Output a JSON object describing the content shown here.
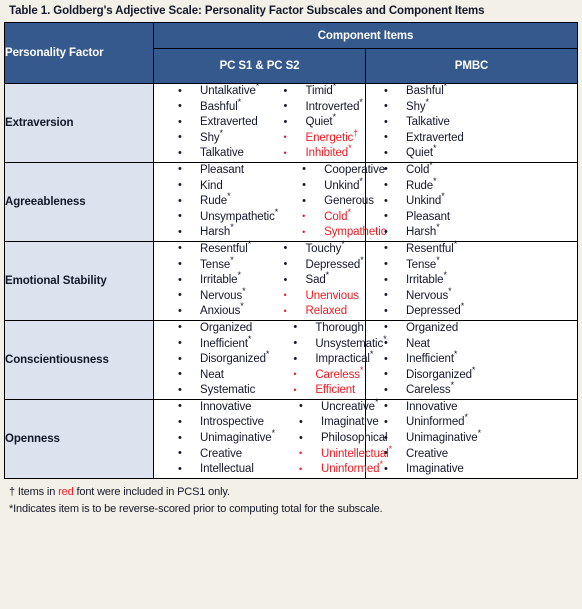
{
  "title": "Table 1. Goldberg's Adjective Scale: Personality Factor Subscales and Component Items",
  "colors": {
    "header_blue": "#35598c",
    "factor_cell_bg": "#dce3ee",
    "red_accent": "#ed1c24",
    "page_bg": "#f3f0e7"
  },
  "header": {
    "factor_label": "Personality Factor",
    "component_items_label": "Component Items",
    "pcs_label": "PC S1 & PC S2",
    "pmbc_label": "PMBC"
  },
  "rows": [
    {
      "factor": "Extraversion",
      "pcs_col1": [
        {
          "text": "Untalkative*",
          "red": false
        },
        {
          "text": "Bashful*",
          "red": false
        },
        {
          "text": "Extraverted",
          "red": false
        },
        {
          "text": "Shy*",
          "red": false
        },
        {
          "text": "Talkative",
          "red": false
        }
      ],
      "pcs_col2": [
        {
          "text": "Timid*",
          "red": false
        },
        {
          "text": "Introverted*",
          "red": false
        },
        {
          "text": "Quiet*",
          "red": false
        },
        {
          "text": "Energetic†",
          "red": true
        },
        {
          "text": "Inhibited*",
          "red": true
        }
      ],
      "pmbc": [
        {
          "text": "Bashful*",
          "red": false
        },
        {
          "text": "Shy*",
          "red": false
        },
        {
          "text": "Talkative",
          "red": false
        },
        {
          "text": "Extraverted",
          "red": false
        },
        {
          "text": "Quiet*",
          "red": false
        }
      ]
    },
    {
      "factor": "Agreeableness",
      "pcs_col1": [
        {
          "text": "Pleasant",
          "red": false
        },
        {
          "text": "Kind",
          "red": false
        },
        {
          "text": "Rude*",
          "red": false
        },
        {
          "text": "Unsympathetic*",
          "red": false
        },
        {
          "text": "Harsh*",
          "red": false
        }
      ],
      "pcs_col2": [
        {
          "text": "Cooperative",
          "red": false
        },
        {
          "text": "Unkind*",
          "red": false
        },
        {
          "text": "Generous",
          "red": false
        },
        {
          "text": "Cold*",
          "red": true
        },
        {
          "text": "Sympathetic",
          "red": true
        }
      ],
      "pmbc": [
        {
          "text": "Cold*",
          "red": false
        },
        {
          "text": "Rude*",
          "red": false
        },
        {
          "text": "Unkind*",
          "red": false
        },
        {
          "text": "Pleasant",
          "red": false
        },
        {
          "text": "Harsh*",
          "red": false
        }
      ]
    },
    {
      "factor": "Emotional Stability",
      "pcs_col1": [
        {
          "text": "Resentful*",
          "red": false
        },
        {
          "text": "Tense*",
          "red": false
        },
        {
          "text": "Irritable*",
          "red": false
        },
        {
          "text": "Nervous*",
          "red": false
        },
        {
          "text": "Anxious*",
          "red": false
        }
      ],
      "pcs_col2": [
        {
          "text": "Touchy*",
          "red": false
        },
        {
          "text": "Depressed*",
          "red": false
        },
        {
          "text": "Sad*",
          "red": false
        },
        {
          "text": "Unenvious",
          "red": true
        },
        {
          "text": "Relaxed",
          "red": true
        }
      ],
      "pmbc": [
        {
          "text": "Resentful*",
          "red": false
        },
        {
          "text": "Tense*",
          "red": false
        },
        {
          "text": "Irritable*",
          "red": false
        },
        {
          "text": "Nervous*",
          "red": false
        },
        {
          "text": "Depressed*",
          "red": false
        }
      ]
    },
    {
      "factor": "Conscientiousness",
      "pcs_col1": [
        {
          "text": "Organized",
          "red": false
        },
        {
          "text": "Inefficient*",
          "red": false
        },
        {
          "text": "Disorganized*",
          "red": false
        },
        {
          "text": "Neat",
          "red": false
        },
        {
          "text": "Systematic",
          "red": false
        }
      ],
      "pcs_col2": [
        {
          "text": "Thorough",
          "red": false
        },
        {
          "text": "Unsystematic*",
          "red": false
        },
        {
          "text": "Impractical*",
          "red": false
        },
        {
          "text": "Careless*",
          "red": true
        },
        {
          "text": "Efficient",
          "red": true
        }
      ],
      "pmbc": [
        {
          "text": "Organized",
          "red": false
        },
        {
          "text": "Neat",
          "red": false
        },
        {
          "text": "Inefficient*",
          "red": false
        },
        {
          "text": "Disorganized*",
          "red": false
        },
        {
          "text": "Careless*",
          "red": false
        }
      ]
    },
    {
      "factor": "Openness",
      "pcs_col1": [
        {
          "text": "Innovative",
          "red": false
        },
        {
          "text": "Introspective",
          "red": false
        },
        {
          "text": "Unimaginative*",
          "red": false
        },
        {
          "text": "Creative",
          "red": false
        },
        {
          "text": "Intellectual",
          "red": false
        }
      ],
      "pcs_col2": [
        {
          "text": "Uncreative*",
          "red": false
        },
        {
          "text": "Imaginative",
          "red": false
        },
        {
          "text": "Philosophical",
          "red": false
        },
        {
          "text": "Unintellectual*",
          "red": true
        },
        {
          "text": "Uninformed*",
          "red": true
        }
      ],
      "pmbc": [
        {
          "text": "Innovative",
          "red": false
        },
        {
          "text": "Uninformed*",
          "red": false
        },
        {
          "text": "Unimaginative*",
          "red": false
        },
        {
          "text": "Creative",
          "red": false
        },
        {
          "text": "Imaginative",
          "red": false
        }
      ]
    }
  ],
  "footnotes": {
    "dagger_prefix": "† Items in ",
    "dagger_redword": "red",
    "dagger_suffix": " font were included in PCS1 only.",
    "asterisk": "*Indicates item is to be reverse-scored prior to computing total for the subscale."
  }
}
